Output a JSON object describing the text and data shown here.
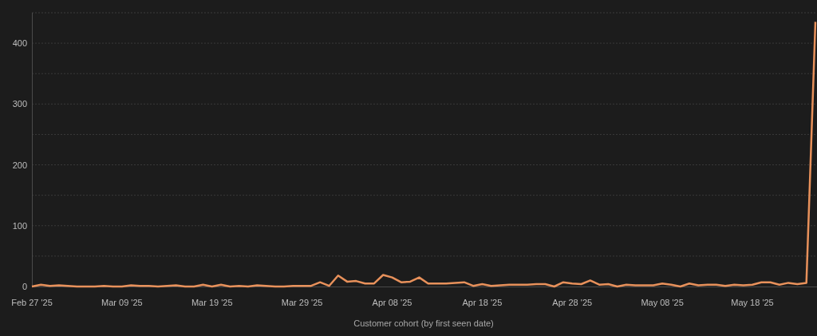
{
  "chart": {
    "chart_data": {
      "type": "line",
      "xlabel": "Customer cohort (by first seen date)",
      "categories": [
        "Feb 27 '25",
        null,
        null,
        null,
        null,
        null,
        null,
        null,
        null,
        null,
        "Mar 09 '25",
        null,
        null,
        null,
        null,
        null,
        null,
        null,
        null,
        null,
        "Mar 19 '25",
        null,
        null,
        null,
        null,
        null,
        null,
        null,
        null,
        null,
        "Mar 29 '25",
        null,
        null,
        null,
        null,
        null,
        null,
        null,
        null,
        null,
        "Apr 08 '25",
        null,
        null,
        null,
        null,
        null,
        null,
        null,
        null,
        null,
        "Apr 18 '25",
        null,
        null,
        null,
        null,
        null,
        null,
        null,
        null,
        null,
        "Apr 28 '25",
        null,
        null,
        null,
        null,
        null,
        null,
        null,
        null,
        null,
        "May 08 '25",
        null,
        null,
        null,
        null,
        null,
        null,
        null,
        null,
        null,
        "May 18 '25",
        null,
        null,
        null,
        null,
        null,
        null,
        null
      ],
      "grid": true,
      "series": [
        {
          "color": "#e8915b",
          "values": [
            0,
            3,
            1,
            2,
            1,
            0,
            0,
            0,
            1,
            0,
            0,
            2,
            1,
            1,
            0,
            1,
            2,
            0,
            0,
            3,
            0,
            3,
            0,
            1,
            0,
            2,
            1,
            0,
            0,
            1,
            1,
            1,
            7,
            1,
            18,
            8,
            9,
            5,
            5,
            19,
            15,
            7,
            8,
            15,
            5,
            5,
            5,
            6,
            7,
            1,
            4,
            1,
            2,
            3,
            3,
            3,
            4,
            4,
            0,
            7,
            5,
            4,
            10,
            3,
            4,
            0,
            3,
            2,
            2,
            2,
            5,
            3,
            0,
            5,
            2,
            3,
            3,
            1,
            3,
            2,
            3,
            7,
            7,
            3,
            6,
            4,
            6,
            435
          ]
        }
      ],
      "ylim": [
        0,
        450
      ],
      "yticks": [
        0,
        100,
        200,
        300,
        400
      ]
    }
  }
}
